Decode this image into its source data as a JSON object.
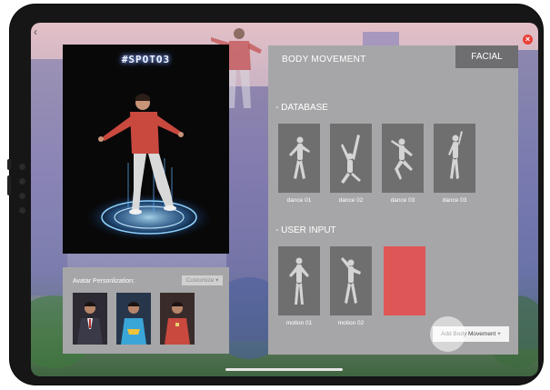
{
  "right_panel": {
    "title": "BODY MOVEMENT",
    "facial_tab": "FACIAL",
    "database": {
      "heading": "- DATABASE",
      "items": [
        {
          "label": "dance 01"
        },
        {
          "label": "dance 02"
        },
        {
          "label": "dance 03"
        },
        {
          "label": "dance 03"
        }
      ]
    },
    "user_input": {
      "heading": "- USER INPUT",
      "items": [
        {
          "label": "motion 01"
        },
        {
          "label": "motion 02"
        }
      ]
    },
    "add_button": "Add Body Movement +"
  },
  "left": {
    "sign_text": "#SPOTO3",
    "personalization": {
      "label": "Avatar Personlization:",
      "customize": "Customize ▾"
    }
  },
  "colors": {
    "panel_gray": "#a6a6a8",
    "tab_dark": "#6e6e70",
    "accent_red": "#df5656",
    "close_red": "#e8413a",
    "hologram_blue": "#5fb2ff"
  },
  "icons": {
    "back": "chevron-left-icon",
    "close": "close-icon"
  }
}
